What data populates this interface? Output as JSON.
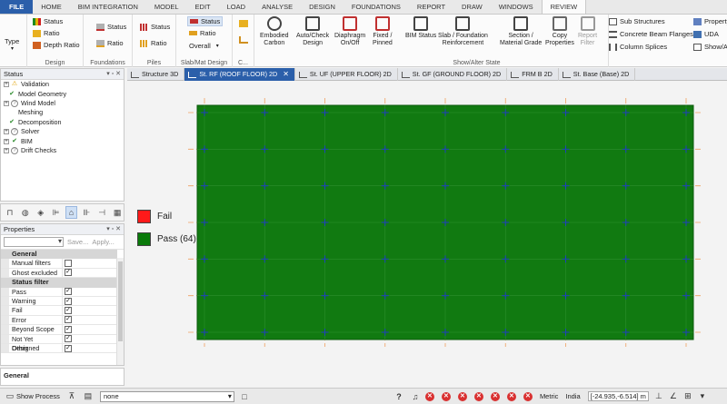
{
  "menu": {
    "tabs": [
      "FILE",
      "HOME",
      "BIM INTEGRATION",
      "MODEL",
      "EDIT",
      "LOAD",
      "ANALYSE",
      "DESIGN",
      "FOUNDATIONS",
      "REPORT",
      "DRAW",
      "WINDOWS",
      "REVIEW"
    ],
    "active": "REVIEW"
  },
  "ribbon": {
    "type_label": "Type",
    "design": {
      "status": "Status",
      "ratio": "Ratio",
      "depth_ratio": "Depth Ratio",
      "group": "Design"
    },
    "foundations": {
      "status": "Status",
      "ratio": "Ratio",
      "group": "Foundations"
    },
    "piles": {
      "status": "Status",
      "ratio": "Ratio",
      "group": "Piles"
    },
    "slab": {
      "status": "Status",
      "ratio": "Ratio",
      "overall": "Overall",
      "group": "Slab/Mat Design"
    },
    "c_group": "C...",
    "big_buttons": [
      {
        "label1": "Embodied",
        "label2": "Carbon"
      },
      {
        "label1": "Auto/Check",
        "label2": "Design"
      },
      {
        "label1": "Diaphragm",
        "label2": "On/Off"
      },
      {
        "label1": "Fixed /",
        "label2": "Pinned"
      },
      {
        "label1": "BIM Status",
        "label2": ""
      },
      {
        "label1": "Slab / Foundation",
        "label2": "Reinforcement"
      },
      {
        "label1": "Section /",
        "label2": "Material Grade"
      },
      {
        "label1": "Copy",
        "label2": "Properties"
      },
      {
        "label1": "Report",
        "label2": "Filter"
      }
    ],
    "right": {
      "sub_structures": "Sub Structures",
      "beam_flanges": "Concrete Beam Flanges",
      "column_splices": "Column Splices",
      "property": "Property",
      "uda": "UDA",
      "show_all": "Show/All"
    },
    "group_show_alter": "Show/Alter State"
  },
  "status_panel": {
    "title": "Status",
    "items": [
      {
        "label": "Validation",
        "state": "warning",
        "expand": "+"
      },
      {
        "label": "Model Geometry",
        "state": "ok",
        "expand": ""
      },
      {
        "label": "Wind Model",
        "state": "unknown",
        "expand": "+"
      },
      {
        "label": "Meshing",
        "state": "none",
        "expand": ""
      },
      {
        "label": "Decomposition",
        "state": "ok",
        "expand": ""
      },
      {
        "label": "Solver",
        "state": "unknown",
        "expand": "+"
      },
      {
        "label": "BIM",
        "state": "ok",
        "expand": "+"
      },
      {
        "label": "Drift Checks",
        "state": "unknown",
        "expand": "+"
      }
    ]
  },
  "properties_panel": {
    "title": "Properties",
    "save": "Save...",
    "apply": "Apply...",
    "categories": [
      {
        "name": "General",
        "rows": [
          {
            "label": "Manual filters",
            "checked": false
          },
          {
            "label": "Ghost excluded",
            "checked": true
          }
        ]
      },
      {
        "name": "Status filter",
        "rows": [
          {
            "label": "Pass",
            "checked": true
          },
          {
            "label": "Warning",
            "checked": true
          },
          {
            "label": "Fail",
            "checked": true
          },
          {
            "label": "Error",
            "checked": true
          },
          {
            "label": "Beyond Scope",
            "checked": true
          },
          {
            "label": "Not Yet Designed",
            "checked": true
          },
          {
            "label": "Other",
            "checked": true
          }
        ]
      }
    ],
    "footer": "General"
  },
  "doc_tabs": [
    {
      "label": "Structure 3D",
      "active": false
    },
    {
      "label": "St. RF (ROOF FLOOR) 2D",
      "active": true
    },
    {
      "label": "St. UF (UPPER FLOOR) 2D",
      "active": false
    },
    {
      "label": "St. GF (GROUND FLOOR) 2D",
      "active": false
    },
    {
      "label": "FRM B 2D",
      "active": false
    },
    {
      "label": "St. Base (Base) 2D",
      "active": false
    }
  ],
  "legend": [
    {
      "label": "Fail",
      "color": "#ff1a1a"
    },
    {
      "label": "Pass (64)",
      "color": "#0a7a0a"
    }
  ],
  "grid": {
    "columns": 8,
    "rows": 6,
    "slab_color": "#117a11"
  },
  "statusbar": {
    "show_process": "Show Process",
    "process_value": "none",
    "units": "Metric",
    "region": "India",
    "coords": "[-24.935,-6.514] m"
  }
}
